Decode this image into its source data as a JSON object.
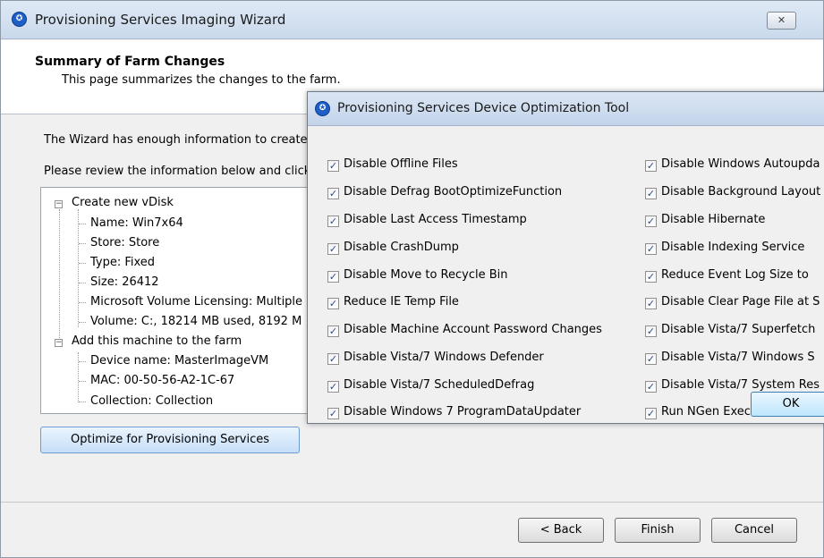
{
  "window": {
    "title": "Provisioning Services Imaging Wizard",
    "close_glyph": "✕"
  },
  "header": {
    "title": "Summary of Farm Changes",
    "subtitle": "This page summarizes the changes to the farm."
  },
  "intro": {
    "line1": "The Wizard has enough information to create",
    "line2": "Please review the information below and click"
  },
  "tree": {
    "vdisk_label": "Create new vDisk",
    "vdisk_items": [
      "Name: Win7x64",
      "Store: Store",
      "Type: Fixed",
      "Size: 26412",
      "Microsoft Volume Licensing: Multiple",
      "Volume: C:, 18214 MB used, 8192 M"
    ],
    "farm_label": "Add this machine to the farm",
    "farm_items": [
      "Device name: MasterImageVM",
      "MAC: 00-50-56-A2-1C-67",
      "Collection: Collection"
    ],
    "collapse_glyph": "−"
  },
  "buttons": {
    "optimize": "Optimize for Provisioning Services",
    "back": "< Back",
    "finish": "Finish",
    "cancel": "Cancel"
  },
  "dialog": {
    "title": "Provisioning Services Device Optimization Tool",
    "ok": "OK",
    "check_glyph": "✓",
    "left_options": [
      {
        "label": "Disable Offline Files",
        "checked": true
      },
      {
        "label": "Disable Defrag BootOptimizeFunction",
        "checked": true
      },
      {
        "label": "Disable Last Access Timestamp",
        "checked": true
      },
      {
        "label": "Disable CrashDump",
        "checked": true
      },
      {
        "label": "Disable Move to Recycle Bin",
        "checked": true
      },
      {
        "label": "Reduce IE Temp File",
        "checked": true
      },
      {
        "label": "Disable Machine Account Password Changes",
        "checked": true
      },
      {
        "label": "Disable Vista/7 Windows Defender",
        "checked": true
      },
      {
        "label": "Disable Vista/7 ScheduledDefrag",
        "checked": true
      },
      {
        "label": "Disable Windows 7 ProgramDataUpdater",
        "checked": true
      }
    ],
    "right_options": [
      {
        "label": "Disable Windows Autoupda",
        "checked": true
      },
      {
        "label": "Disable Background Layout",
        "checked": true
      },
      {
        "label": "Disable Hibernate",
        "checked": true
      },
      {
        "label": "Disable Indexing Service",
        "checked": true
      },
      {
        "label": "Reduce Event Log Size to",
        "checked": true
      },
      {
        "label": "Disable Clear Page File at S",
        "checked": true
      },
      {
        "label": "Disable Vista/7 Superfetch",
        "checked": true
      },
      {
        "label": "Disable Vista/7 Windows S",
        "checked": true
      },
      {
        "label": "Disable Vista/7 System Res",
        "checked": true
      },
      {
        "label": "Run NGen ExecuteQueued",
        "checked": true
      }
    ]
  }
}
